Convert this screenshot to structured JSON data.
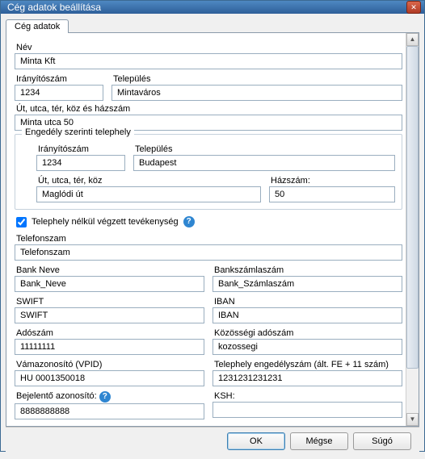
{
  "window": {
    "title": "Cég adatok beállítása"
  },
  "tabs": {
    "main": "Cég adatok"
  },
  "labels": {
    "name": "Név",
    "zip": "Irányítószám",
    "city": "Település",
    "street": "Út, utca, tér, köz és házszám",
    "permit_group": "Engedély szerinti telephely",
    "permit_zip": "Irányítószám",
    "permit_city": "Település",
    "permit_street": "Út, utca, tér, köz",
    "permit_house": "Házszám:",
    "no_site": "Telephely nélkül végzett tevékenység",
    "phone": "Telefonszam",
    "bank_name": "Bank Neve",
    "bank_account": "Bankszámlaszám",
    "swift": "SWIFT",
    "iban": "IBAN",
    "tax": "Adószám",
    "eu_tax": "Közösségi adószám",
    "vpid": "Vámazonosító (VPID)",
    "site_permit_no": "Telephely engedélyszám (ált. FE + 11 szám)",
    "reporter_id": "Bejelentő azonosító:",
    "ksh": "KSH:"
  },
  "values": {
    "name": "Minta Kft",
    "zip": "1234",
    "city": "Mintaváros",
    "street": "Minta utca 50",
    "permit_zip": "1234",
    "permit_city": "Budapest",
    "permit_street": "Maglódi út",
    "permit_house": "50",
    "no_site_checked": true,
    "phone": "Telefonszam",
    "bank_name": "Bank_Neve",
    "bank_account": "Bank_Számlaszám",
    "swift": "SWIFT",
    "iban": "IBAN",
    "tax": "11111111",
    "eu_tax": "kozossegi",
    "vpid": "HU 0001350018",
    "site_permit_no": "1231231231231",
    "reporter_id": "8888888888",
    "ksh": ""
  },
  "buttons": {
    "ok": "OK",
    "cancel": "Mégse",
    "help": "Súgó"
  },
  "icons": {
    "help_glyph": "?"
  }
}
